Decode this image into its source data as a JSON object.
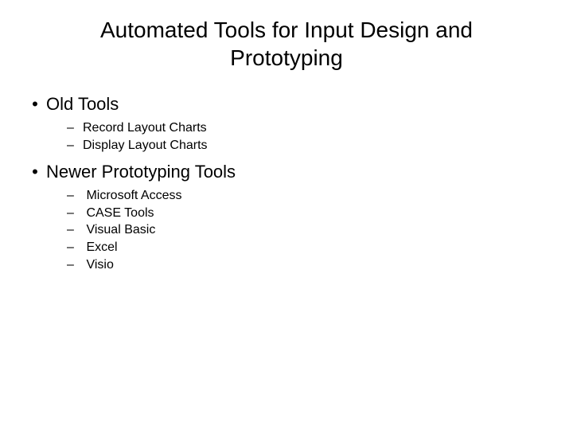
{
  "title": "Automated Tools for Input Design and Prototyping",
  "sections": [
    {
      "heading": "Old Tools",
      "items": [
        "Record Layout Charts",
        "Display Layout Charts"
      ]
    },
    {
      "heading": "Newer Prototyping Tools",
      "items": [
        "Microsoft Access",
        "CASE Tools",
        "Visual Basic",
        "Excel",
        "Visio"
      ]
    }
  ]
}
